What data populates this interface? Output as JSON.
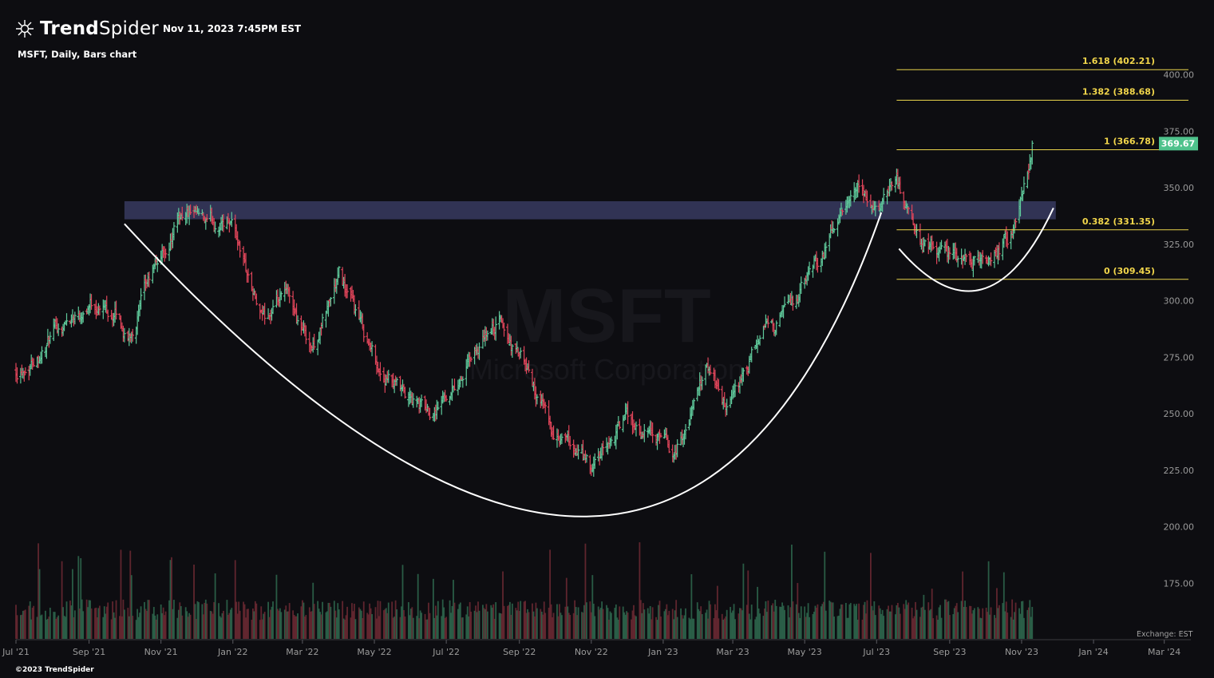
{
  "header": {
    "brand_bold": "Trend",
    "brand_regular": "Spider",
    "timestamp": "Nov 11, 2023 7:45PM EST",
    "subtitle": "MSFT, Daily, Bars chart",
    "exchange": "Exchange: EST",
    "footer": "©2023 TrendSpider"
  },
  "watermark": {
    "ticker": "MSFT",
    "company": "Microsoft Corporation"
  },
  "colors": {
    "background": "#0d0d11",
    "up": "#5fc99b",
    "down": "#e0455a",
    "fib_line": "#e8d34b",
    "fib_text": "#f2d64b",
    "resistance_zone": "#343658",
    "curve": "#ffffff",
    "price_badge": "#4fc28c"
  },
  "chart_data": {
    "type": "ohlc-bar",
    "title": "MSFT, Daily, Bars chart",
    "y_axis": {
      "ticks": [
        175,
        200,
        225,
        250,
        275,
        300,
        325,
        350,
        375,
        400
      ],
      "tick_labels": [
        "175.00",
        "200.00",
        "225.00",
        "250.00",
        "275.00",
        "300.00",
        "325.00",
        "350.00",
        "375.00",
        "400.00"
      ],
      "range": [
        168,
        412
      ]
    },
    "x_axis": {
      "labels": [
        "Jul '21",
        "Sep '21",
        "Nov '21",
        "Jan '22",
        "Mar '22",
        "May '22",
        "Jul '22",
        "Sep '22",
        "Nov '22",
        "Jan '23",
        "Mar '23",
        "May '23",
        "Jul '23",
        "Sep '23",
        "Nov '23",
        "Jan '24",
        "Mar '24"
      ],
      "range": [
        "2021-07-01",
        "2024-03-31"
      ]
    },
    "price_path": [
      [
        "2021-07-01",
        270
      ],
      [
        "2021-08-01",
        285
      ],
      [
        "2021-09-01",
        302
      ],
      [
        "2021-09-25",
        295
      ],
      [
        "2021-10-03",
        282
      ],
      [
        "2021-10-20",
        305
      ],
      [
        "2021-11-20",
        340
      ],
      [
        "2021-12-10",
        330
      ],
      [
        "2021-12-31",
        338
      ],
      [
        "2022-01-25",
        290
      ],
      [
        "2022-02-15",
        300
      ],
      [
        "2022-03-10",
        280
      ],
      [
        "2022-04-01",
        310
      ],
      [
        "2022-05-05",
        270
      ],
      [
        "2022-05-25",
        255
      ],
      [
        "2022-06-15",
        250
      ],
      [
        "2022-07-10",
        265
      ],
      [
        "2022-08-15",
        290
      ],
      [
        "2022-09-05",
        270
      ],
      [
        "2022-10-01",
        238
      ],
      [
        "2022-10-25",
        230
      ],
      [
        "2022-11-01",
        222
      ],
      [
        "2022-11-30",
        248
      ],
      [
        "2022-12-28",
        236
      ],
      [
        "2023-01-10",
        232
      ],
      [
        "2023-02-08",
        270
      ],
      [
        "2023-02-25",
        250
      ],
      [
        "2023-03-31",
        288
      ],
      [
        "2023-04-25",
        300
      ],
      [
        "2023-05-25",
        330
      ],
      [
        "2023-06-15",
        345
      ],
      [
        "2023-07-01",
        338
      ],
      [
        "2023-07-18",
        358
      ],
      [
        "2023-08-05",
        325
      ],
      [
        "2023-08-25",
        320
      ],
      [
        "2023-09-20",
        318
      ],
      [
        "2023-10-01",
        315
      ],
      [
        "2023-10-25",
        330
      ],
      [
        "2023-11-10",
        369.67
      ]
    ],
    "last_price": 369.67,
    "last_price_label": "369.67",
    "fibonacci": [
      {
        "level": "1.618",
        "value": 402.21,
        "label": "1.618 (402.21)"
      },
      {
        "level": "1.382",
        "value": 388.68,
        "label": "1.382 (388.68)"
      },
      {
        "level": "1",
        "value": 366.78,
        "label": "1 (366.78)"
      },
      {
        "level": "0.382",
        "value": 331.35,
        "label": "0.382 (331.35)"
      },
      {
        "level": "0",
        "value": 309.45,
        "label": "0 (309.45)"
      }
    ],
    "fibonacci_start": "2023-07-18",
    "resistance_zone": {
      "from": "2021-10-01",
      "to": "2023-11-30",
      "low": 336,
      "high": 344
    },
    "cup": {
      "start": [
        "2021-10-01",
        334
      ],
      "bottom": [
        "2022-10-28",
        204.5
      ],
      "end": [
        "2023-07-05",
        339
      ]
    },
    "handle": {
      "start": [
        "2023-07-20",
        323
      ],
      "bottom": [
        "2023-09-28",
        305
      ],
      "end": [
        "2023-11-28",
        341
      ]
    },
    "volume": {
      "typical_height_fraction": 0.3,
      "max_height_fraction": 1.0
    }
  }
}
